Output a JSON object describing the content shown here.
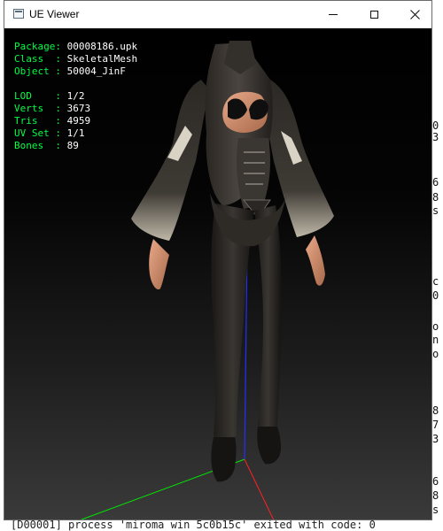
{
  "window": {
    "title": "UE Viewer"
  },
  "info": {
    "package": {
      "label": "Package: ",
      "value": "00008186.upk"
    },
    "class": {
      "label": "Class  : ",
      "value": "SkeletalMesh"
    },
    "object": {
      "label": "Object : ",
      "value": "50004_JinF"
    },
    "lod": {
      "label": "LOD    : ",
      "value": "1/2"
    },
    "verts": {
      "label": "Verts  : ",
      "value": "3673"
    },
    "tris": {
      "label": "Tris   : ",
      "value": "4959"
    },
    "uvset": {
      "label": "UV Set : ",
      "value": "1/1"
    },
    "bones": {
      "label": "Bones  : ",
      "value": "89"
    }
  },
  "console": {
    "side_chars": [
      "0",
      "3",
      "6",
      "8",
      "s",
      "c",
      "0",
      "o",
      "n",
      "o",
      "8",
      "7",
      "3",
      "6",
      "8",
      "s"
    ],
    "bottom_line": "[D00001] process 'miroma win 5c0b15c' exited with code: 0"
  },
  "colors": {
    "label_green": "#00ff44",
    "axis_x": "#ff2020",
    "axis_y": "#00ee00",
    "axis_z": "#2030ff"
  },
  "icons": {
    "app": "app-window-icon",
    "minimize": "minimize-icon",
    "maximize": "maximize-icon",
    "close": "close-icon"
  }
}
